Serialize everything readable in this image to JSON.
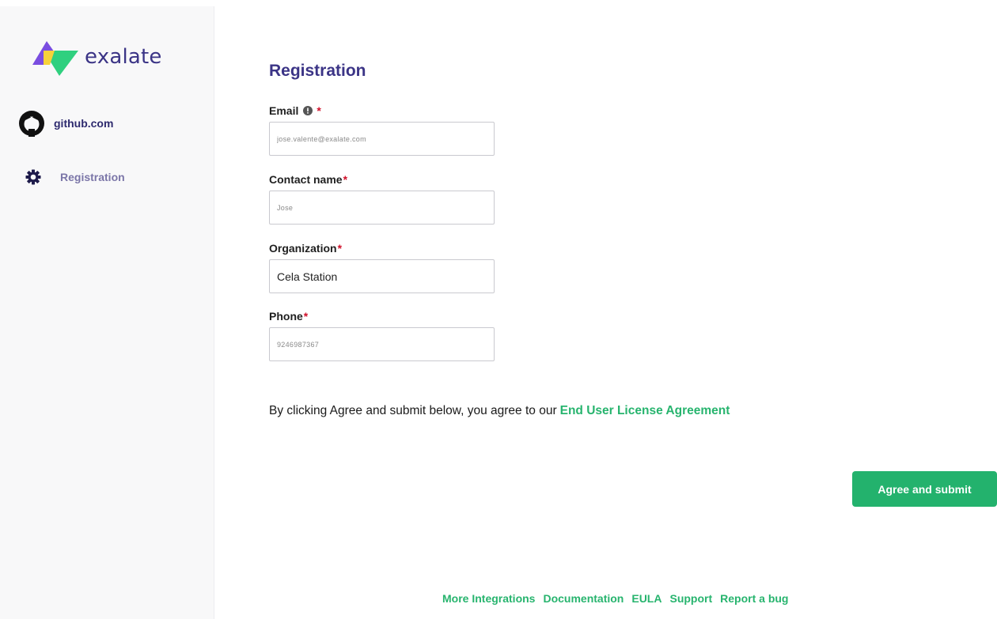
{
  "brand": {
    "name": "exalate",
    "accent": "#3b3486",
    "logo_colors": [
      "#7a4de0",
      "#2fd07f",
      "#f7d23a"
    ]
  },
  "sidebar": {
    "items": [
      {
        "label": "github.com",
        "icon": "github-icon"
      },
      {
        "label": "Registration",
        "icon": "gear-icon"
      }
    ]
  },
  "main": {
    "title": "Registration",
    "fields": {
      "email": {
        "label": "Email",
        "required": "*",
        "value": "jose.valente@exalate.com",
        "icon": "info-icon"
      },
      "contact_name": {
        "label": "Contact name",
        "required": "*",
        "value": "Jose"
      },
      "organization": {
        "label": "Organization",
        "required": "*",
        "value": "Cela Station"
      },
      "phone": {
        "label": "Phone",
        "required": "*",
        "value": "9246987367"
      }
    },
    "agreement": {
      "text": "By clicking Agree and submit below, you agree to our",
      "link": "End User License Agreement"
    },
    "submit_label": "Agree and submit",
    "submit_color": "#23b26d"
  },
  "footer": {
    "links": [
      "More Integrations",
      "Documentation",
      "EULA",
      "Support",
      "Report a bug"
    ],
    "link_color": "#27b46e"
  }
}
